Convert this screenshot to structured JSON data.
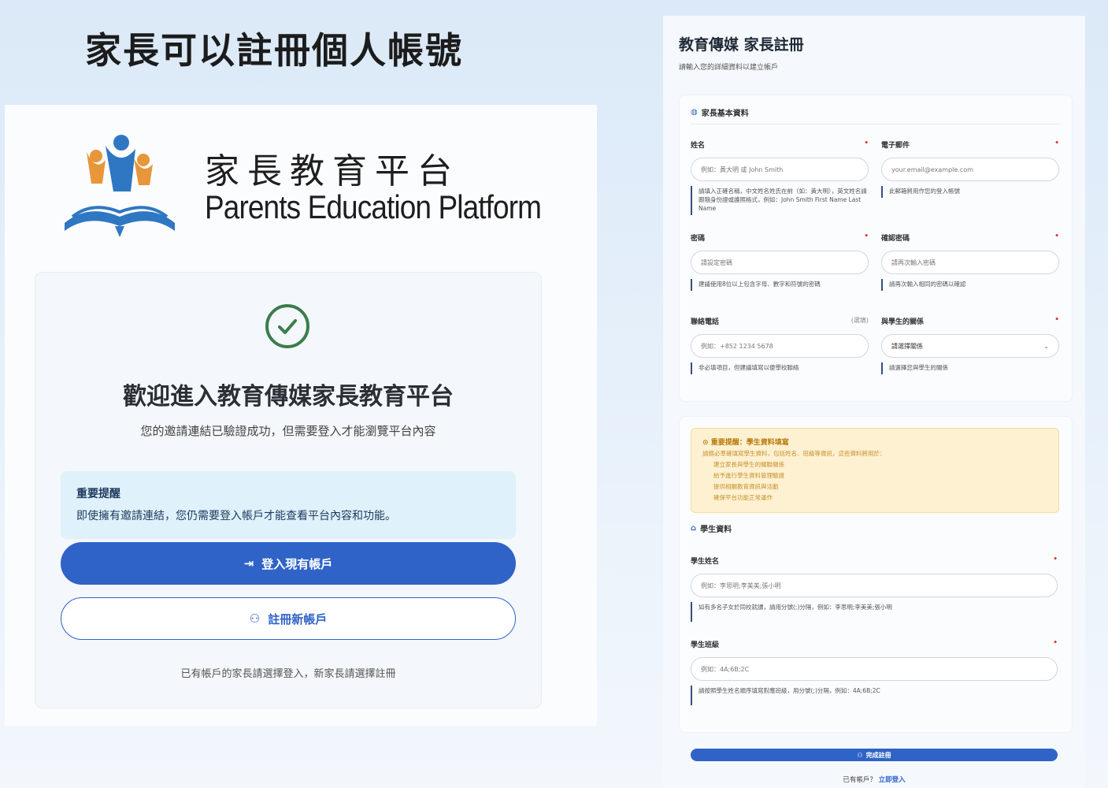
{
  "heading": "家長可以註冊個人帳號",
  "left": {
    "brand_zh": "家長教育平台",
    "brand_en": "Parents Education Platform",
    "welcome_title": "歡迎進入教育傳媒家長教育平台",
    "welcome_sub": "您的邀請連結已驗證成功，但需要登入才能瀏覽平台內容",
    "notice_title": "重要提醒",
    "notice_body": "即使擁有邀請連結，您仍需要登入帳戶才能查看平台內容和功能。",
    "login_button": "登入現有帳戶",
    "register_button": "註冊新帳戶",
    "footer": "已有帳戶的家長請選擇登入，新家長請選擇註冊"
  },
  "right": {
    "title": "教育傳媒 家長註冊",
    "subtitle": "請輸入您的詳細資料以建立帳戶",
    "parent_section": "家長基本資料",
    "name_label": "姓名",
    "name_placeholder": "例如：黃大明 或 John Smith",
    "name_hint": "請填入正確名稱，中文姓名姓氏在前（如：黃大明），英文姓名請跟隨身份證或護照格式，例如：John Smith First Name Last Name",
    "email_label": "電子郵件",
    "email_placeholder": "your.email@example.com",
    "email_hint": "此郵箱將用作您的登入帳號",
    "password_label": "密碼",
    "password_placeholder": "請設定密碼",
    "password_hint": "建議使用8位以上包含字母、數字和符號的密碼",
    "confirm_label": "確認密碼",
    "confirm_placeholder": "請再次輸入密碼",
    "confirm_hint": "請再次輸入相同的密碼以確認",
    "phone_label": "聯絡電話",
    "phone_optional": "(選填)",
    "phone_placeholder": "例如：+852 1234 5678",
    "phone_hint": "非必填項目，但建議填寫以便學校聯絡",
    "relation_label": "與學生的關係",
    "relation_selected": "請選擇關係",
    "relation_hint": "請選擇您與學生的關係",
    "warn_title": "重要提醒：學生資料填寫",
    "warn_intro": "請務必準確填寫學生資料，包括姓名、班級等資訊，這些資料將用於：",
    "warn_items": [
      "建立家長與學生的關聯關係",
      "給予進行學生資料管理驗證",
      "提供相關教育資訊與活動",
      "確保平台功能正常運作"
    ],
    "student_section": "學生資料",
    "student_name_label": "學生姓名",
    "student_name_placeholder": "例如：李思明;李美美;張小明",
    "student_name_hint": "如有多名子女於同校就讀，請用分號(;)分隔，例如：李思明;李美美;張小明",
    "class_label": "學生班級",
    "class_placeholder": "例如：4A;6B;2C",
    "class_hint": "請按照學生姓名順序填寫對應班級，用分號(;)分隔，例如：4A;6B;2C",
    "submit": "完成註冊",
    "login_prompt": "已有帳戶？",
    "login_link": "立即登入"
  }
}
